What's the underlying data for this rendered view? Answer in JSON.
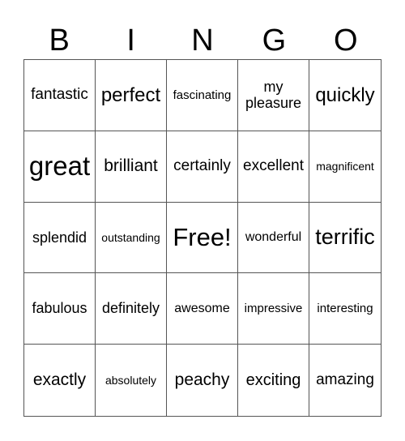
{
  "header": {
    "letters": [
      "B",
      "I",
      "N",
      "G",
      "O"
    ]
  },
  "grid": {
    "rows": [
      [
        "fantastic",
        "perfect",
        "fascinating",
        "my pleasure",
        "quickly"
      ],
      [
        "great",
        "brilliant",
        "certainly",
        "excellent",
        "magnificent"
      ],
      [
        "splendid",
        "outstanding",
        "Free!",
        "wonderful",
        "terrific"
      ],
      [
        "fabulous",
        "definitely",
        "awesome",
        "impressive",
        "interesting"
      ],
      [
        "exactly",
        "absolutely",
        "peachy",
        "exciting",
        "amazing"
      ]
    ],
    "free_space": {
      "row": 2,
      "col": 2,
      "label": "Free!"
    }
  },
  "colors": {
    "text": "#000000",
    "grid_line": "#555555",
    "background": "#ffffff"
  }
}
